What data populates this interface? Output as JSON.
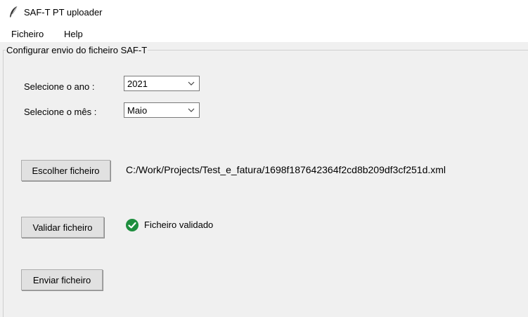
{
  "window": {
    "title": "SAF-T PT uploader",
    "icon": "feather-icon"
  },
  "menu": {
    "items": [
      "Ficheiro",
      "Help"
    ]
  },
  "group": {
    "label": "Configurar envio do ficheiro SAF-T"
  },
  "year": {
    "label": "Selecione o ano :",
    "value": "2021"
  },
  "month": {
    "label": "Selecione o mês :",
    "value": "Maio"
  },
  "choose": {
    "button": "Escolher ficheiro",
    "path": "C:/Work/Projects/Test_e_fatura/1698f187642364f2cd8b209df3cf251d.xml"
  },
  "validate": {
    "button": "Validar ficheiro",
    "status": "Ficheiro validado",
    "status_icon": "check-circle-icon",
    "status_color": "#1e8e3e"
  },
  "send": {
    "button": "Enviar ficheiro"
  }
}
